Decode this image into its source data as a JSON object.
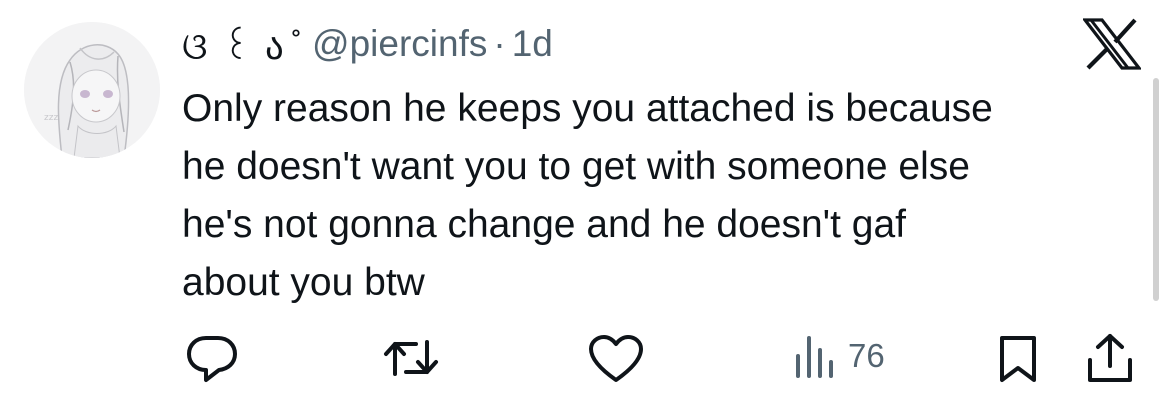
{
  "tweet": {
    "display_name": "ଓ ꒰ ა ̊",
    "handle": "@piercinfs",
    "separator": "·",
    "time": "1d",
    "text": "Only reason he keeps you attached is because\nhe doesn't want you to get with someone else\nhe's not gonna change and he doesn't gaf\nabout you btw"
  },
  "actions": {
    "reply_icon": "reply-icon",
    "retweet_icon": "retweet-icon",
    "like_icon": "heart-icon",
    "views_icon": "views-bar-chart-icon",
    "views_count": "76",
    "bookmark_icon": "bookmark-icon",
    "share_icon": "share-icon"
  },
  "colors": {
    "text_primary": "#0f1419",
    "text_secondary": "#536471",
    "background": "#ffffff"
  }
}
